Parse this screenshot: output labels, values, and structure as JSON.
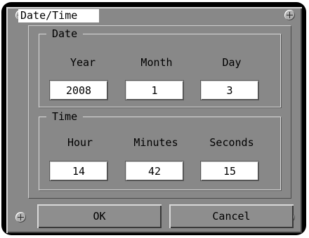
{
  "dialog": {
    "title": "Date/Time"
  },
  "date_group": {
    "legend": "Date",
    "labels": {
      "year": "Year",
      "month": "Month",
      "day": "Day"
    },
    "values": {
      "year": "2008",
      "month": "1",
      "day": "3"
    }
  },
  "time_group": {
    "legend": "Time",
    "labels": {
      "hour": "Hour",
      "minutes": "Minutes",
      "seconds": "Seconds"
    },
    "values": {
      "hour": "14",
      "minutes": "42",
      "seconds": "15"
    }
  },
  "buttons": {
    "ok": "OK",
    "cancel": "Cancel"
  },
  "icons": {
    "corner": "plus-circle-icon"
  },
  "colors": {
    "panel": "#888888",
    "frame": "#000000",
    "field": "#ffffff"
  }
}
